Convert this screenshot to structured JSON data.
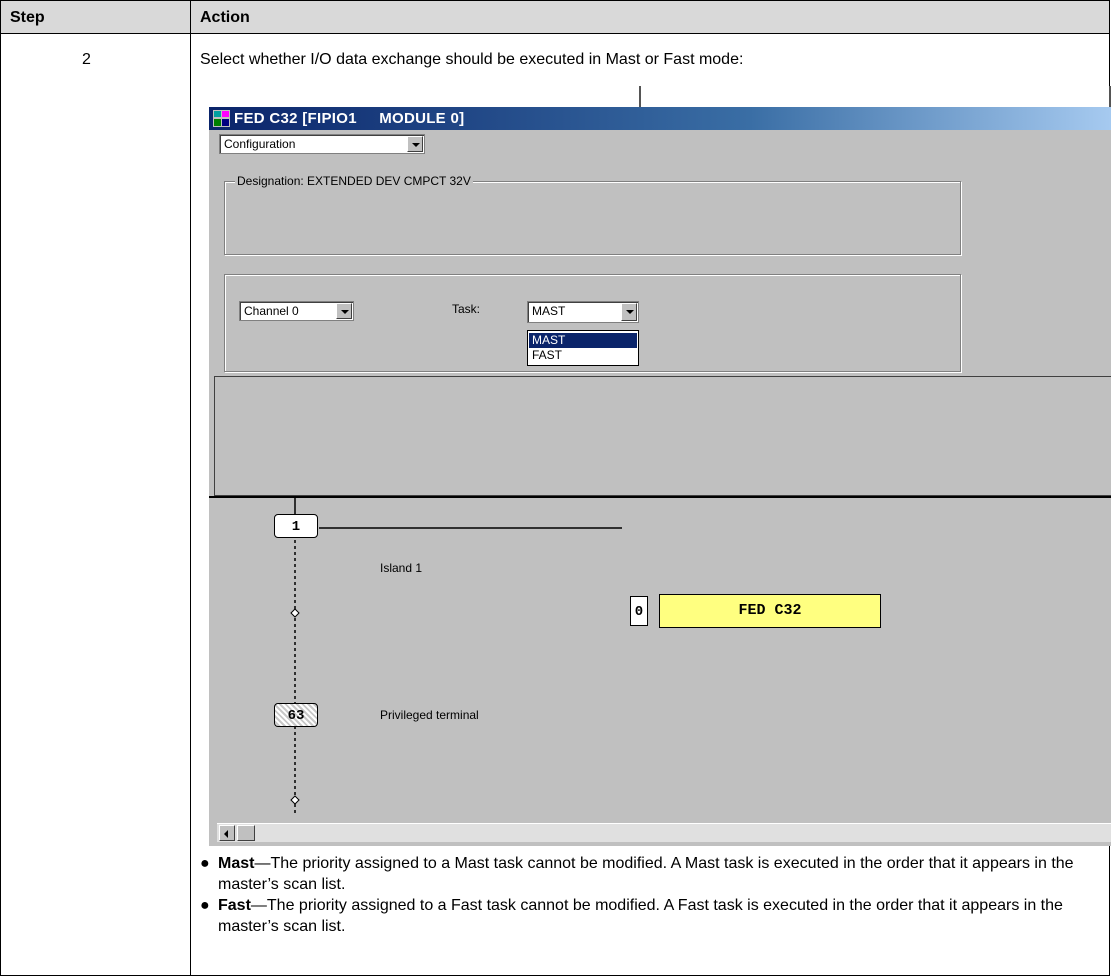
{
  "table": {
    "header_step": "Step",
    "header_action": "Action",
    "step_number": "2",
    "intro": "Select whether I/O data exchange should be executed in Mast or Fast mode:"
  },
  "window": {
    "title": "FED C32 [FIPIO1     MODULE 0]",
    "view_select": "Configuration",
    "designation": "Designation: EXTENDED DEV CMPCT 32V",
    "channel_select": "Channel 0",
    "task_label": "Task:",
    "task_select": "MAST",
    "task_options": [
      "MAST",
      "FAST"
    ]
  },
  "diagram": {
    "island_node": "1",
    "island_label": "Island 1",
    "terminal_node": "63",
    "terminal_label": "Privileged terminal",
    "slot": "0",
    "device": "FED C32",
    "device_color": "#ffff80"
  },
  "bullets": [
    {
      "term": "Mast",
      "text": "—The priority assigned to a Mast task cannot be modified. A Mast task is executed in the order that it appears in the master’s scan list."
    },
    {
      "term": "Fast",
      "text": "—The priority assigned to a Fast task cannot be modified. A Fast task is executed in the order that it appears in the master’s scan list."
    }
  ]
}
